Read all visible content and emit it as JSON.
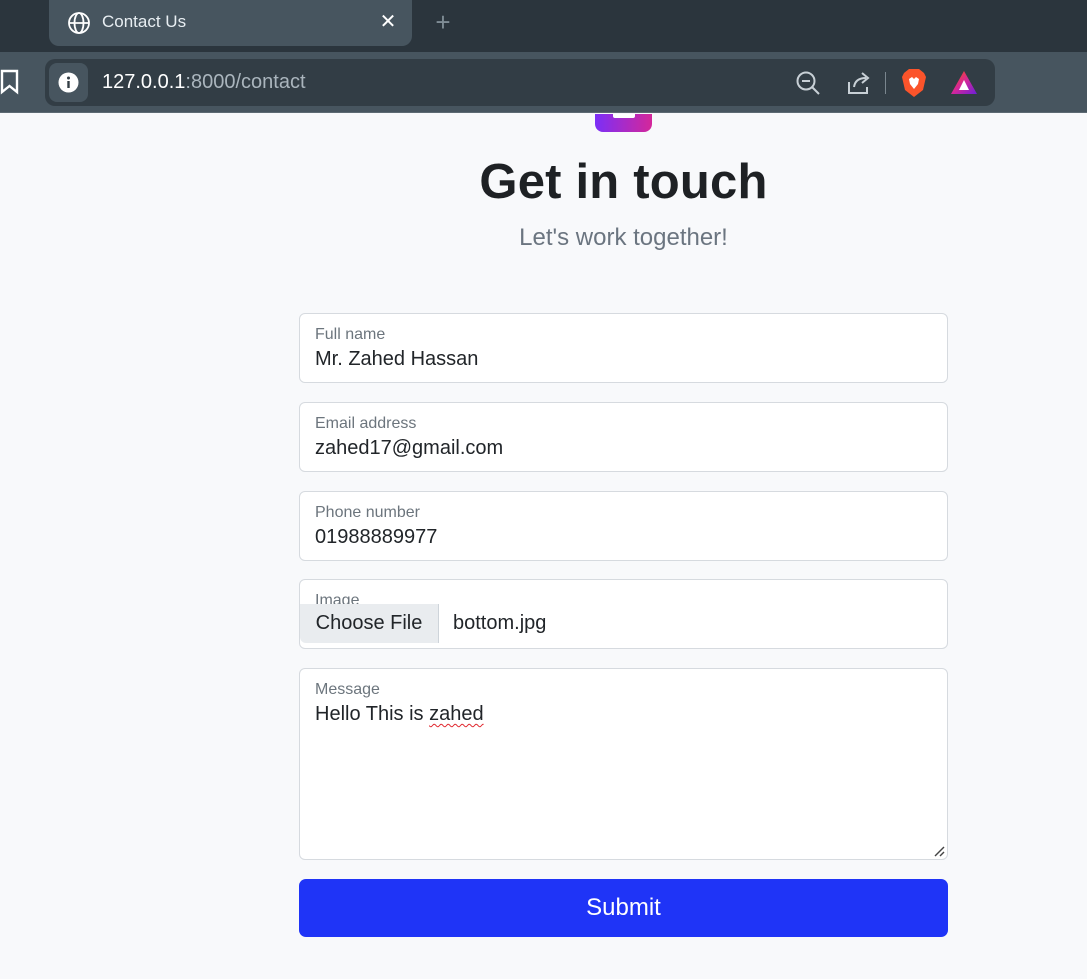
{
  "browser": {
    "tab_title": "Contact Us",
    "url_host": "127.0.0.1",
    "url_path": ":8000/contact",
    "icons": [
      "globe-icon",
      "close-icon",
      "plus-icon",
      "bookmark-icon",
      "info-icon",
      "zoom-out-icon",
      "share-icon",
      "brave-shield-icon",
      "brave-rewards-icon"
    ]
  },
  "page": {
    "heading": "Get in touch",
    "subheading": "Let's work together!",
    "form": {
      "full_name": {
        "label": "Full name",
        "value": "Mr. Zahed Hassan"
      },
      "email": {
        "label": "Email address",
        "value": "zahed17@gmail.com"
      },
      "phone": {
        "label": "Phone number",
        "value": "01988889977"
      },
      "image": {
        "label": "Image",
        "button": "Choose File",
        "file_name": "bottom.jpg"
      },
      "message": {
        "label": "Message",
        "text_part1": "Hello This is ",
        "text_misspelled": "zahed"
      },
      "submit_label": "Submit"
    }
  },
  "colors": {
    "accent": "#1f34f7",
    "logo_gradient_start": "#7b2ff7",
    "logo_gradient_end": "#d4279a",
    "tab_bar": "#2b353d",
    "toolbar": "#47555f"
  }
}
